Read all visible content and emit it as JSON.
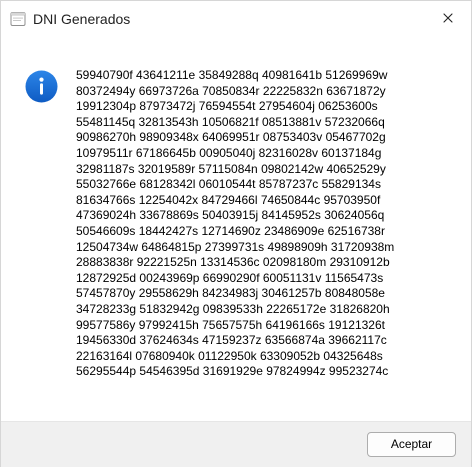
{
  "window": {
    "title": "DNI Generados"
  },
  "dialog": {
    "message": "59940790f 43641211e 35849288q 40981641b 51269969w\n80372494y 66973726a 70850834r 22225832n 63671872y\n19912304p 87973472j 76594554t 27954604j 06253600s\n55481145q 32813543h 10506821f 08513881v 57232066q\n90986270h 98909348x 64069951r 08753403v 05467702g\n10979511r 67186645b 00905040j 82316028v 60137184g\n32981187s 32019589r 57115084n 09802142w 40652529y\n55032766e 68128342l 06010544t 85787237c 55829134s\n81634766s 12254042x 84729466l 74650844c 95703950f\n47369024h 33678869s 50403915j 84145952s 30624056q\n50546609s 18442427s 12714690z 23486909e 62516738r\n12504734w 64864815p 27399731s 49898909h 31720938m\n28883838r 92221525n 13314536c 02098180m 29310912b\n12872925d 00243969p 66990290f 60051131v 11565473s\n57457870y 29558629h 84234983j 30461257b 80848058e\n34728233g 51832942g 09839533h 22265172e 31826820h\n99577586y 97992415h 75657575h 64196166s 19121326t\n19456330d 37624634s 47159237z 63566874a 39662117c\n22163164l 07680940k 01122950k 63309052b 04325648s\n56295544p 54546395d 31691929e 97824994z 99523274c",
    "accept_label": "Aceptar"
  },
  "icons": {
    "app": "window-icon",
    "info": "info-icon",
    "close": "close-icon"
  },
  "colors": {
    "info_blue": "#1f6fd6",
    "footer": "#f0f0f0"
  }
}
